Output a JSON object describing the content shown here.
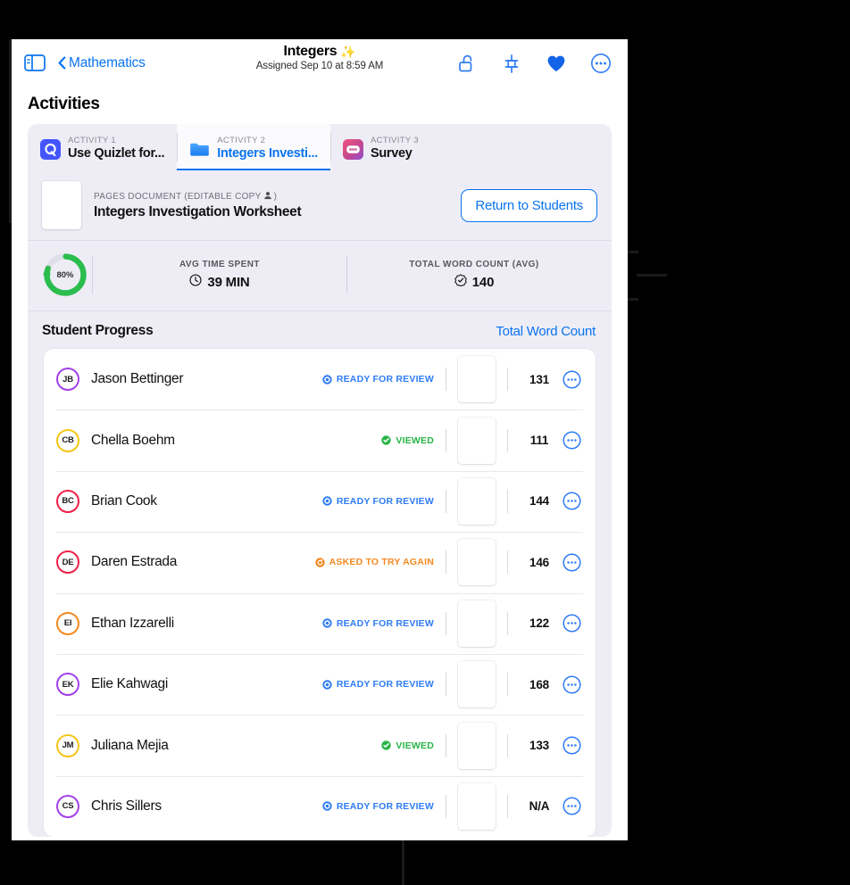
{
  "navbar": {
    "sidebar_toggle_icon": "sidebar-icon",
    "back_label": "Mathematics",
    "title": "Integers",
    "title_sparkle": "✨",
    "subtitle": "Assigned Sep 10 at 8:59 AM",
    "icons": [
      {
        "name": "unlock-icon",
        "label": "Unlock"
      },
      {
        "name": "pin-icon",
        "label": "Pin"
      },
      {
        "name": "heart-icon",
        "label": "Favorite"
      },
      {
        "name": "more-options-icon",
        "label": "More"
      }
    ]
  },
  "page": {
    "heading": "Activities"
  },
  "tabs": [
    {
      "kicker": "ACTIVITY 1",
      "label": "Use Quizlet for...",
      "icon": "quizlet-icon",
      "active": false
    },
    {
      "kicker": "ACTIVITY 2",
      "label": "Integers Investi...",
      "icon": "pages-folder-icon",
      "active": true
    },
    {
      "kicker": "ACTIVITY 3",
      "label": "Survey",
      "icon": "survey-icon",
      "active": false
    }
  ],
  "document": {
    "kicker": "PAGES DOCUMENT (EDITABLE COPY",
    "kicker_icon": "person-icon",
    "kicker_close": ")",
    "title": "Integers Investigation Worksheet",
    "thumbnail_icon": "worksheet-thumbnail",
    "return_button": "Return to Students"
  },
  "stats": {
    "progress_percent": "80%",
    "progress_value": 80,
    "progress_color": "#2bbd4e",
    "cells": [
      {
        "label": "AVG TIME SPENT",
        "value": "39 MIN",
        "icon": "clock-icon"
      },
      {
        "label": "TOTAL WORD COUNT (AVG)",
        "value": "140",
        "icon": "checkmark-seal-icon"
      }
    ]
  },
  "student_progress": {
    "title": "Student Progress",
    "link": "Total Word Count"
  },
  "statuses": {
    "ready": {
      "label": "READY FOR REVIEW",
      "color": "#2f7cf6",
      "icon": "ready-circle-icon"
    },
    "viewed": {
      "label": "VIEWED",
      "color": "#28b446",
      "icon": "viewed-check-icon"
    },
    "retry": {
      "label": "ASKED TO TRY AGAIN",
      "color": "#f5881f",
      "icon": "retry-circle-icon"
    }
  },
  "students": [
    {
      "initials": "JB",
      "name": "Jason Bettinger",
      "color": "#a340e8",
      "status": "ready",
      "word_count": "131"
    },
    {
      "initials": "CB",
      "name": "Chella Boehm",
      "color": "#f5c518",
      "status": "viewed",
      "word_count": "111"
    },
    {
      "initials": "BC",
      "name": "Brian Cook",
      "color": "#ef1f46",
      "status": "ready",
      "word_count": "144"
    },
    {
      "initials": "DE",
      "name": "Daren Estrada",
      "color": "#ef1f46",
      "status": "retry",
      "word_count": "146"
    },
    {
      "initials": "EI",
      "name": "Ethan Izzarelli",
      "color": "#f5881f",
      "status": "ready",
      "word_count": "122"
    },
    {
      "initials": "EK",
      "name": "Elie Kahwagi",
      "color": "#a340e8",
      "status": "ready",
      "word_count": "168"
    },
    {
      "initials": "JM",
      "name": "Juliana Mejia",
      "color": "#f5c518",
      "status": "viewed",
      "word_count": "133"
    },
    {
      "initials": "CS",
      "name": "Chris Sillers",
      "color": "#a340e8",
      "status": "ready",
      "word_count": "N/A"
    }
  ],
  "row_icons": {
    "thumbnail": "worksheet-thumbnail",
    "more": "row-more-options-icon"
  },
  "theme": {
    "accent": "#0a74f0",
    "card_bg": "#eeedf6",
    "window_bg": "#ffffff",
    "backdrop": "#000000"
  }
}
